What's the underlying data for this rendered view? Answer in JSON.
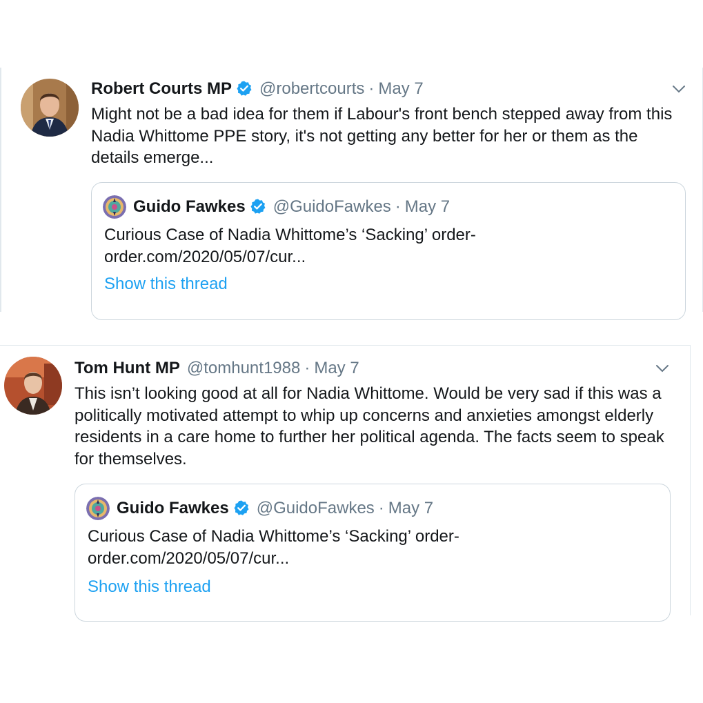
{
  "tweets": [
    {
      "author": {
        "display_name": "Robert Courts MP",
        "verified": true,
        "handle": "@robertcourts",
        "avatar_icon": "avatar-photo"
      },
      "separator": "·",
      "date": "May 7",
      "text": "Might not be a bad idea for them if Labour's front bench stepped away from this Nadia Whittome PPE story, it's not getting any better for her or them as the details emerge...",
      "menu_icon": "chevron-down-icon",
      "quote": {
        "display_name": "Guido Fawkes",
        "verified": true,
        "handle": "@GuidoFawkes",
        "separator": "·",
        "date": "May 7",
        "text": "Curious Case of Nadia Whittome’s ‘Sacking’ order-order.com/2020/05/07/cur...",
        "show_thread": "Show this thread"
      }
    },
    {
      "author": {
        "display_name": "Tom Hunt MP",
        "verified": false,
        "handle": "@tomhunt1988",
        "avatar_icon": "avatar-photo"
      },
      "separator": "·",
      "date": "May 7",
      "text": "This isn’t looking good at all for Nadia Whittome. Would be very sad if this was a politically motivated attempt to whip up concerns and anxieties amongst elderly residents in a care home to further her political agenda. The facts seem to speak for themselves.",
      "menu_icon": "chevron-down-icon",
      "quote": {
        "display_name": "Guido Fawkes",
        "verified": true,
        "handle": "@GuidoFawkes",
        "separator": "·",
        "date": "May 7",
        "text": "Curious Case of Nadia Whittome’s ‘Sacking’ order-order.com/2020/05/07/cur...",
        "show_thread": "Show this thread"
      }
    }
  ],
  "colors": {
    "link": "#1da1f2",
    "verified": "#1da1f2",
    "muted": "#657786",
    "border": "#ccd6dd"
  }
}
